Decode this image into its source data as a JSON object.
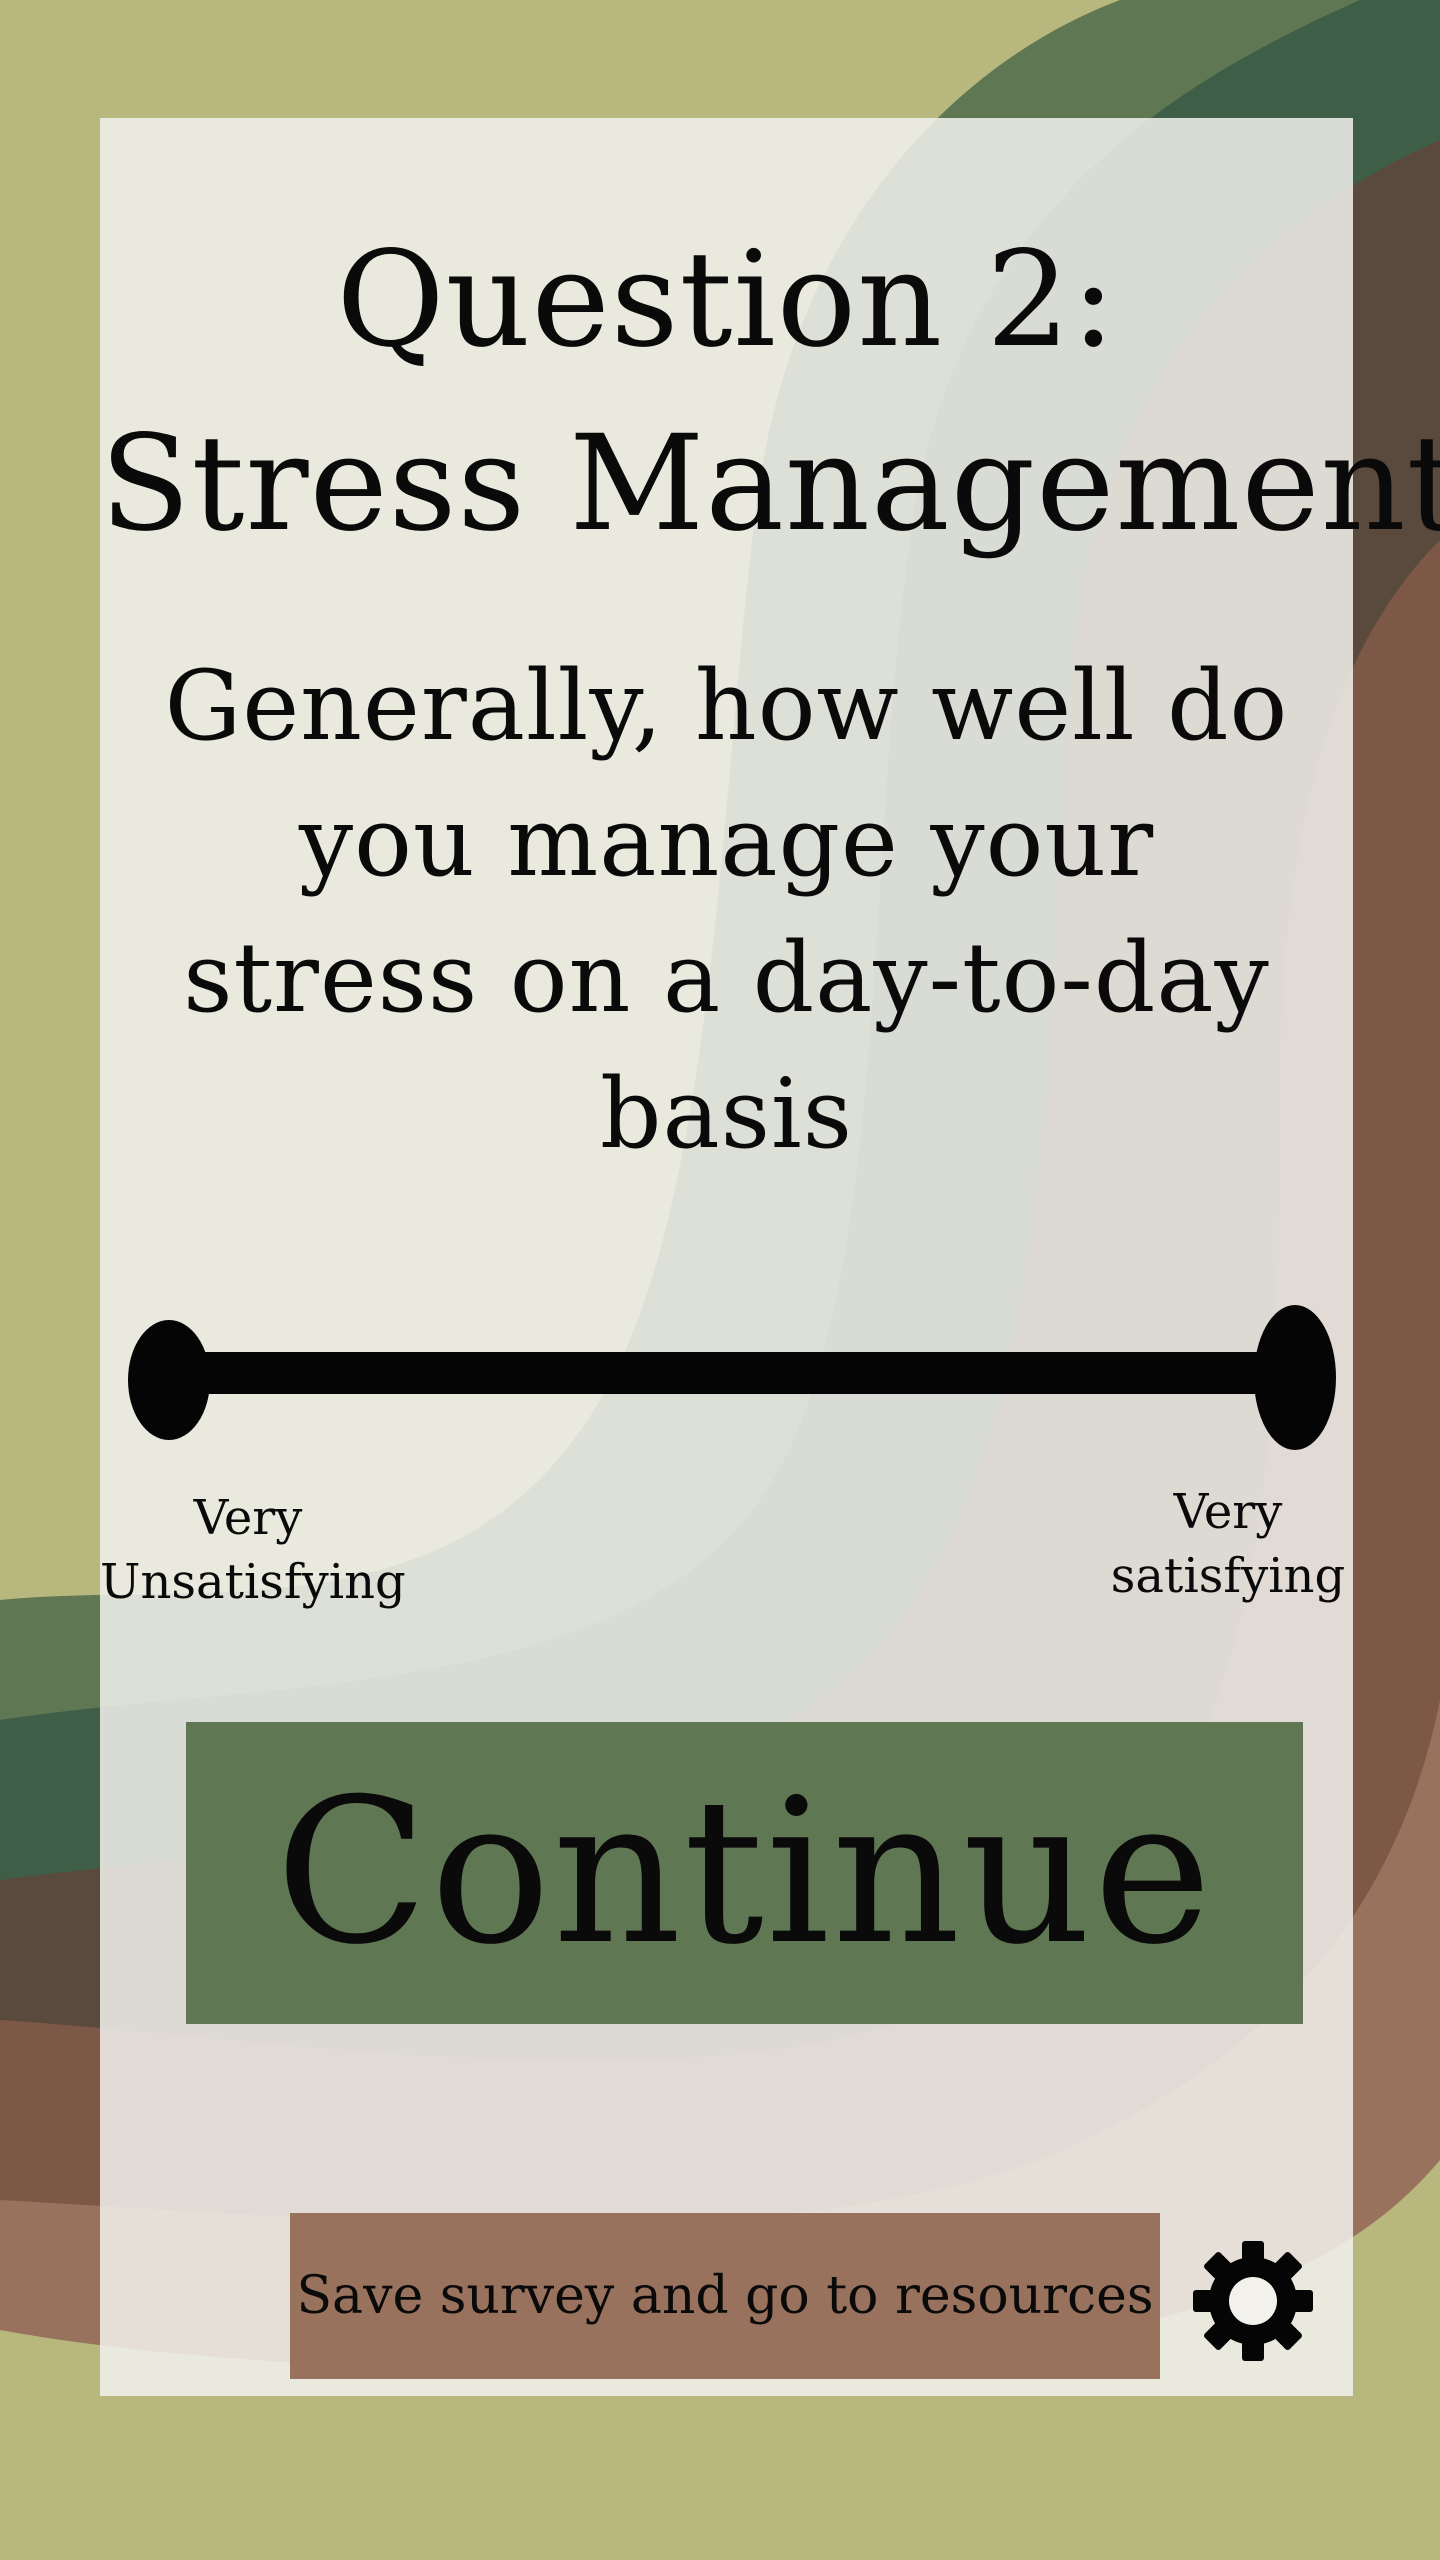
{
  "question": {
    "title_line1": "Question 2:",
    "title_line2": "Stress Management",
    "text": "Generally, how well do you manage your stress on a day-to-day basis"
  },
  "scale": {
    "left_label_line1": "Very",
    "left_label_line2": "Unsatisfying",
    "right_label_line1": "Very",
    "right_label_line2": "satisfying"
  },
  "buttons": {
    "continue_label": "Continue",
    "resources_label": "Save survey and go to resources",
    "settings_icon": "gear-icon"
  },
  "colors": {
    "background_olive": "#b7b77e",
    "green_dark": "#3e5e47",
    "green_mid": "#5f7752",
    "brown_dark": "#5a4a3e",
    "brown_mid": "#7e5846",
    "brown_light": "#99725d",
    "card": "#f2f1ec",
    "continue_button": "#5f7752",
    "resources_button": "#99725d"
  }
}
